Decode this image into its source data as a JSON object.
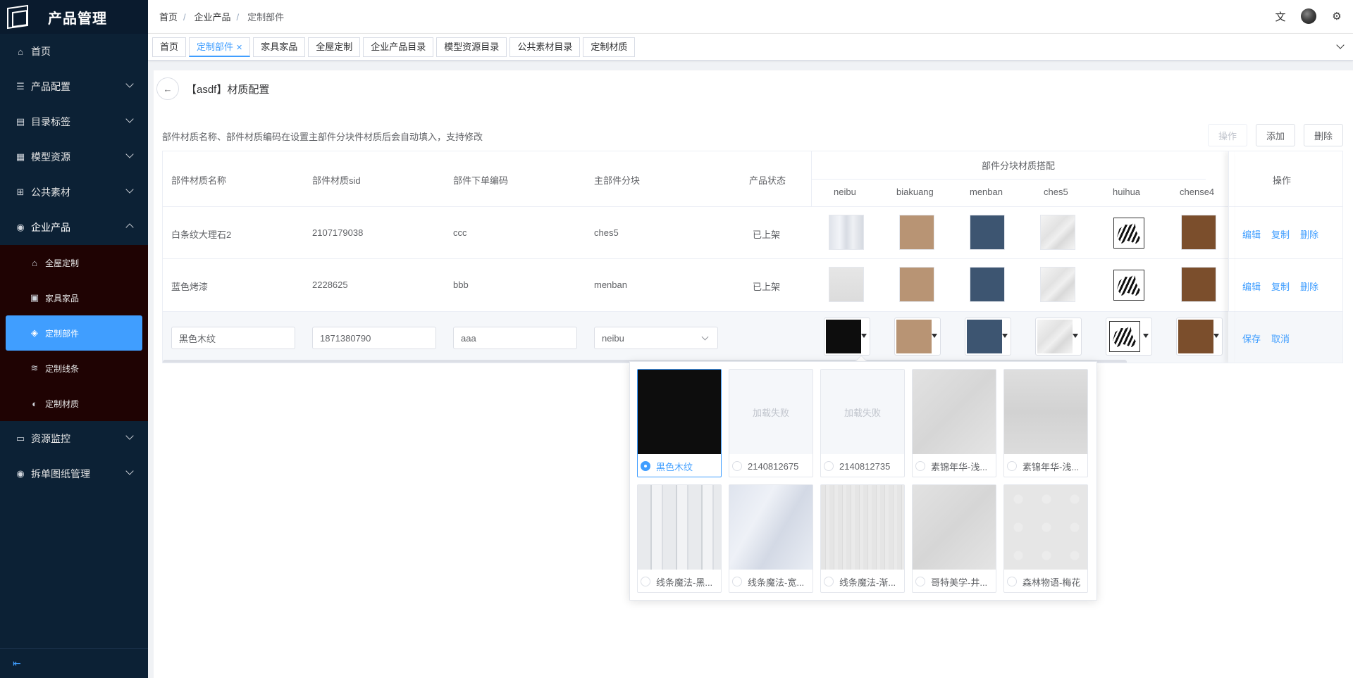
{
  "app": {
    "title": "产品管理"
  },
  "sidebar": {
    "items": [
      {
        "label": "首页",
        "icon": "home-icon"
      },
      {
        "label": "产品配置",
        "icon": "list-icon"
      },
      {
        "label": "目录标签",
        "icon": "document-icon"
      },
      {
        "label": "模型资源",
        "icon": "grid-icon"
      },
      {
        "label": "公共素材",
        "icon": "table-icon"
      },
      {
        "label": "企业产品",
        "icon": "database-icon"
      },
      {
        "label": "资源监控",
        "icon": "monitor-icon"
      },
      {
        "label": "拆单图纸管理",
        "icon": "database-icon"
      }
    ],
    "submenu": [
      {
        "label": "全屋定制",
        "icon": "house-icon"
      },
      {
        "label": "家具家品",
        "icon": "cabinet-icon"
      },
      {
        "label": "定制部件",
        "icon": "layers-icon"
      },
      {
        "label": "定制线条",
        "icon": "wind-icon"
      },
      {
        "label": "定制材质",
        "icon": "palette-icon"
      }
    ],
    "collapse_icon": "collapse-icon"
  },
  "header": {
    "breadcrumb": [
      "首页",
      "企业产品",
      "定制部件"
    ],
    "icons": [
      "translate-icon",
      "avatar",
      "gear-icon"
    ]
  },
  "tabs": [
    {
      "label": "首页"
    },
    {
      "label": "定制部件",
      "active": true
    },
    {
      "label": "家具家品"
    },
    {
      "label": "全屋定制"
    },
    {
      "label": "企业产品目录"
    },
    {
      "label": "模型资源目录"
    },
    {
      "label": "公共素材目录"
    },
    {
      "label": "定制材质"
    }
  ],
  "page": {
    "title": "【asdf】材质配置",
    "hint": "部件材质名称、部件材质编码在设置主部件分块件材质后会自动填入，支持修改",
    "toolbar": {
      "operate": "操作",
      "add": "添加",
      "delete": "删除"
    }
  },
  "table": {
    "headers": {
      "name": "部件材质名称",
      "sid": "部件材质sid",
      "order_code": "部件下单编码",
      "main_block": "主部件分块",
      "status": "产品状态",
      "group": "部件分块材质搭配",
      "blocks": [
        "neibu",
        "biakuang",
        "menban",
        "ches5",
        "huihua",
        "chense4"
      ],
      "ops": "操作"
    },
    "rows": [
      {
        "name": "白条纹大理石2",
        "sid": "2107179038",
        "order_code": "ccc",
        "main_block": "ches5",
        "status": "已上架",
        "swatches": [
          "t-marble1",
          "t-tan",
          "t-navy",
          "t-marble2",
          "t-zebra",
          "t-brown"
        ],
        "ops": [
          "编辑",
          "复制",
          "删除"
        ]
      },
      {
        "name": "蓝色烤漆",
        "sid": "2228625",
        "order_code": "bbb",
        "main_block": "menban",
        "status": "已上架",
        "swatches": [
          "t-grey",
          "t-tan",
          "t-navy",
          "t-marble2",
          "t-zebra",
          "t-brown"
        ],
        "ops": [
          "编辑",
          "复制",
          "删除"
        ]
      }
    ],
    "edit_row": {
      "name": "黑色木纹",
      "sid": "1871380790",
      "order_code": "aaa",
      "main_block": "neibu",
      "swatches": [
        "t-black",
        "t-tan",
        "t-navy",
        "t-marble2",
        "t-zebra",
        "t-brown"
      ],
      "ops": [
        "保存",
        "取消"
      ]
    }
  },
  "popup": {
    "items": [
      {
        "label": "黑色木纹",
        "texture": "t-black",
        "selected": true
      },
      {
        "label": "2140812675",
        "failed": "加载失败"
      },
      {
        "label": "2140812735",
        "failed": "加载失败"
      },
      {
        "label": "素锦年华-浅...",
        "texture": "tx4"
      },
      {
        "label": "素锦年华-浅...",
        "texture": "tx6"
      },
      {
        "label": "线条魔法-黑...",
        "texture": "tx1"
      },
      {
        "label": "线条魔法-宽...",
        "texture": "tx2"
      },
      {
        "label": "线条魔法-渐...",
        "texture": "tx3"
      },
      {
        "label": "哥特美学-井...",
        "texture": "tx4"
      },
      {
        "label": "森林物语-梅花",
        "texture": "tx5"
      }
    ]
  }
}
